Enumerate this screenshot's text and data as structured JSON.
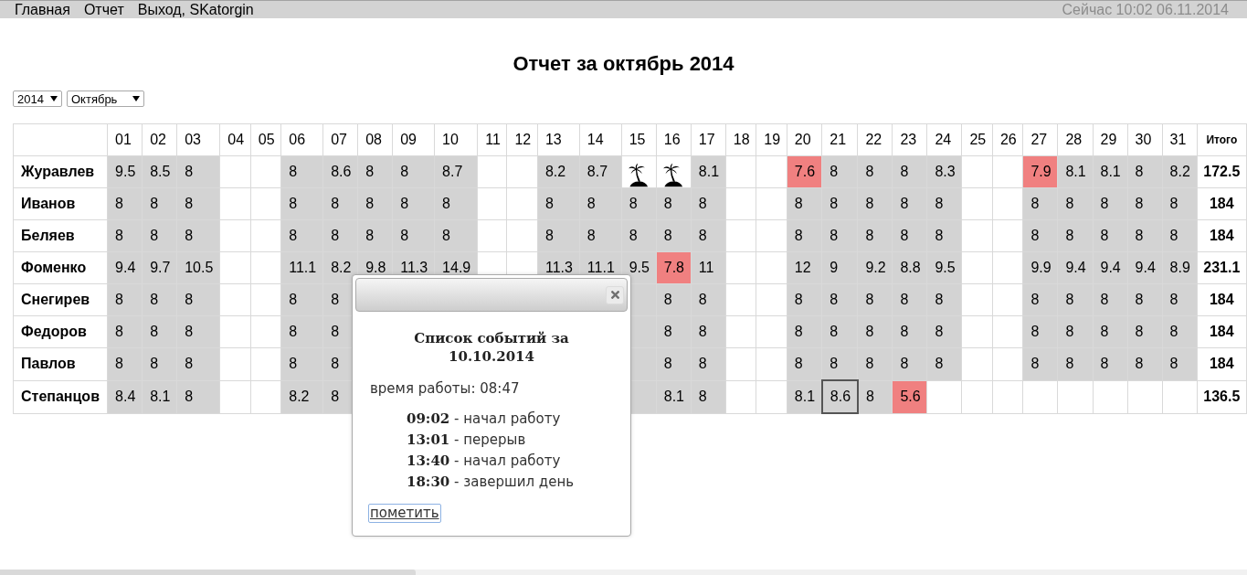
{
  "top_bar": {
    "menu": [
      {
        "label": "Главная"
      },
      {
        "label": "Отчет"
      },
      {
        "label": "Выход, SKatorgin"
      }
    ],
    "clock": "Сейчас 10:02 06.11.2014"
  },
  "title": "Отчет за октябрь 2014",
  "filters": [
    {
      "value": "2014"
    },
    {
      "value": "Октябрь"
    }
  ],
  "table": {
    "columns": [
      "01",
      "02",
      "03",
      "04",
      "05",
      "06",
      "07",
      "08",
      "09",
      "10",
      "11",
      "12",
      "13",
      "14",
      "15",
      "16",
      "17",
      "18",
      "19",
      "20",
      "21",
      "22",
      "23",
      "24",
      "25",
      "26",
      "27",
      "28",
      "29",
      "30",
      "31"
    ],
    "total_column": "Итого",
    "rows": [
      {
        "name": "Журавлев",
        "total": "172.5",
        "cells": [
          {
            "kind": "work",
            "value": "9.5",
            "selected": false
          },
          {
            "kind": "work",
            "value": "8.5",
            "selected": false
          },
          {
            "kind": "work",
            "value": "8",
            "selected": false
          },
          {
            "kind": "weekend",
            "selected": false
          },
          {
            "kind": "weekend",
            "selected": false
          },
          {
            "kind": "work",
            "value": "8",
            "selected": false
          },
          {
            "kind": "work",
            "value": "8.6",
            "selected": false
          },
          {
            "kind": "work",
            "value": "8",
            "selected": false
          },
          {
            "kind": "work",
            "value": "8",
            "selected": false
          },
          {
            "kind": "work",
            "value": "8.7",
            "selected": false
          },
          {
            "kind": "weekend",
            "selected": false
          },
          {
            "kind": "weekend",
            "selected": false
          },
          {
            "kind": "work",
            "value": "8.2",
            "selected": false
          },
          {
            "kind": "work",
            "value": "8.7",
            "selected": false
          },
          {
            "kind": "vacation",
            "selected": false
          },
          {
            "kind": "vacation",
            "selected": false
          },
          {
            "kind": "work",
            "value": "8.1",
            "selected": false
          },
          {
            "kind": "weekend",
            "selected": false
          },
          {
            "kind": "weekend",
            "selected": false
          },
          {
            "kind": "short",
            "value": "7.6",
            "selected": false
          },
          {
            "kind": "work",
            "value": "8",
            "selected": false
          },
          {
            "kind": "work",
            "value": "8",
            "selected": false
          },
          {
            "kind": "work",
            "value": "8",
            "selected": false
          },
          {
            "kind": "work",
            "value": "8.3",
            "selected": false
          },
          {
            "kind": "weekend",
            "selected": false
          },
          {
            "kind": "weekend",
            "selected": false
          },
          {
            "kind": "short",
            "value": "7.9",
            "selected": false
          },
          {
            "kind": "work",
            "value": "8.1",
            "selected": false
          },
          {
            "kind": "work",
            "value": "8.1",
            "selected": false
          },
          {
            "kind": "work",
            "value": "8",
            "selected": false
          },
          {
            "kind": "work",
            "value": "8.2",
            "selected": false
          }
        ]
      },
      {
        "name": "Иванов",
        "total": "184",
        "cells": [
          {
            "kind": "work",
            "value": "8",
            "selected": false
          },
          {
            "kind": "work",
            "value": "8",
            "selected": false
          },
          {
            "kind": "work",
            "value": "8",
            "selected": false
          },
          {
            "kind": "weekend",
            "selected": false
          },
          {
            "kind": "weekend",
            "selected": false
          },
          {
            "kind": "work",
            "value": "8",
            "selected": false
          },
          {
            "kind": "work",
            "value": "8",
            "selected": false
          },
          {
            "kind": "work",
            "value": "8",
            "selected": false
          },
          {
            "kind": "work",
            "value": "8",
            "selected": false
          },
          {
            "kind": "work",
            "value": "8",
            "selected": false
          },
          {
            "kind": "weekend",
            "selected": false
          },
          {
            "kind": "weekend",
            "selected": false
          },
          {
            "kind": "work",
            "value": "8",
            "selected": false
          },
          {
            "kind": "work",
            "value": "8",
            "selected": false
          },
          {
            "kind": "work",
            "value": "8",
            "selected": false
          },
          {
            "kind": "work",
            "value": "8",
            "selected": false
          },
          {
            "kind": "work",
            "value": "8",
            "selected": false
          },
          {
            "kind": "weekend",
            "selected": false
          },
          {
            "kind": "weekend",
            "selected": false
          },
          {
            "kind": "work",
            "value": "8",
            "selected": false
          },
          {
            "kind": "work",
            "value": "8",
            "selected": false
          },
          {
            "kind": "work",
            "value": "8",
            "selected": false
          },
          {
            "kind": "work",
            "value": "8",
            "selected": false
          },
          {
            "kind": "work",
            "value": "8",
            "selected": false
          },
          {
            "kind": "weekend",
            "selected": false
          },
          {
            "kind": "weekend",
            "selected": false
          },
          {
            "kind": "work",
            "value": "8",
            "selected": false
          },
          {
            "kind": "work",
            "value": "8",
            "selected": false
          },
          {
            "kind": "work",
            "value": "8",
            "selected": false
          },
          {
            "kind": "work",
            "value": "8",
            "selected": false
          },
          {
            "kind": "work",
            "value": "8",
            "selected": false
          }
        ]
      },
      {
        "name": "Беляев",
        "total": "184",
        "cells": [
          {
            "kind": "work",
            "value": "8",
            "selected": false
          },
          {
            "kind": "work",
            "value": "8",
            "selected": false
          },
          {
            "kind": "work",
            "value": "8",
            "selected": false
          },
          {
            "kind": "weekend",
            "selected": false
          },
          {
            "kind": "weekend",
            "selected": false
          },
          {
            "kind": "work",
            "value": "8",
            "selected": false
          },
          {
            "kind": "work",
            "value": "8",
            "selected": false
          },
          {
            "kind": "work",
            "value": "8",
            "selected": false
          },
          {
            "kind": "work",
            "value": "8",
            "selected": false
          },
          {
            "kind": "work",
            "value": "8",
            "selected": false
          },
          {
            "kind": "weekend",
            "selected": false
          },
          {
            "kind": "weekend",
            "selected": false
          },
          {
            "kind": "work",
            "value": "8",
            "selected": false
          },
          {
            "kind": "work",
            "value": "8",
            "selected": false
          },
          {
            "kind": "work",
            "value": "8",
            "selected": false
          },
          {
            "kind": "work",
            "value": "8",
            "selected": false
          },
          {
            "kind": "work",
            "value": "8",
            "selected": false
          },
          {
            "kind": "weekend",
            "selected": false
          },
          {
            "kind": "weekend",
            "selected": false
          },
          {
            "kind": "work",
            "value": "8",
            "selected": false
          },
          {
            "kind": "work",
            "value": "8",
            "selected": false
          },
          {
            "kind": "work",
            "value": "8",
            "selected": false
          },
          {
            "kind": "work",
            "value": "8",
            "selected": false
          },
          {
            "kind": "work",
            "value": "8",
            "selected": false
          },
          {
            "kind": "weekend",
            "selected": false
          },
          {
            "kind": "weekend",
            "selected": false
          },
          {
            "kind": "work",
            "value": "8",
            "selected": false
          },
          {
            "kind": "work",
            "value": "8",
            "selected": false
          },
          {
            "kind": "work",
            "value": "8",
            "selected": false
          },
          {
            "kind": "work",
            "value": "8",
            "selected": false
          },
          {
            "kind": "work",
            "value": "8",
            "selected": false
          }
        ]
      },
      {
        "name": "Фоменко",
        "total": "231.1",
        "cells": [
          {
            "kind": "work",
            "value": "9.4",
            "selected": false
          },
          {
            "kind": "work",
            "value": "9.7",
            "selected": false
          },
          {
            "kind": "work",
            "value": "10.5",
            "selected": false
          },
          {
            "kind": "weekend",
            "selected": false
          },
          {
            "kind": "weekend",
            "selected": false
          },
          {
            "kind": "work",
            "value": "11.1",
            "selected": false
          },
          {
            "kind": "work",
            "value": "8.2",
            "selected": false
          },
          {
            "kind": "work",
            "value": "9.8",
            "selected": false
          },
          {
            "kind": "work",
            "value": "11.3",
            "selected": false
          },
          {
            "kind": "work",
            "value": "14.9",
            "selected": false
          },
          {
            "kind": "weekend",
            "selected": false
          },
          {
            "kind": "weekend",
            "selected": false
          },
          {
            "kind": "work",
            "value": "11.3",
            "selected": false
          },
          {
            "kind": "work",
            "value": "11.1",
            "selected": false
          },
          {
            "kind": "work",
            "value": "9.5",
            "selected": false
          },
          {
            "kind": "short",
            "value": "7.8",
            "selected": false
          },
          {
            "kind": "work",
            "value": "11",
            "selected": false
          },
          {
            "kind": "weekend",
            "selected": false
          },
          {
            "kind": "weekend",
            "selected": false
          },
          {
            "kind": "work",
            "value": "12",
            "selected": false
          },
          {
            "kind": "work",
            "value": "9",
            "selected": false
          },
          {
            "kind": "work",
            "value": "9.2",
            "selected": false
          },
          {
            "kind": "work",
            "value": "8.8",
            "selected": false
          },
          {
            "kind": "work",
            "value": "9.5",
            "selected": false
          },
          {
            "kind": "weekend",
            "selected": false
          },
          {
            "kind": "weekend",
            "selected": false
          },
          {
            "kind": "work",
            "value": "9.9",
            "selected": false
          },
          {
            "kind": "work",
            "value": "9.4",
            "selected": false
          },
          {
            "kind": "work",
            "value": "9.4",
            "selected": false
          },
          {
            "kind": "work",
            "value": "9.4",
            "selected": false
          },
          {
            "kind": "work",
            "value": "8.9",
            "selected": false
          }
        ]
      },
      {
        "name": "Снегирев",
        "total": "184",
        "cells": [
          {
            "kind": "work",
            "value": "8",
            "selected": false
          },
          {
            "kind": "work",
            "value": "8",
            "selected": false
          },
          {
            "kind": "work",
            "value": "8",
            "selected": false
          },
          {
            "kind": "weekend",
            "selected": false
          },
          {
            "kind": "weekend",
            "selected": false
          },
          {
            "kind": "work",
            "value": "8",
            "selected": false
          },
          {
            "kind": "work",
            "value": "8",
            "selected": false
          },
          null,
          null,
          null,
          null,
          null,
          null,
          null,
          {
            "kind": "work",
            "selected": false
          },
          {
            "kind": "work",
            "value": "8",
            "selected": false
          },
          {
            "kind": "work",
            "value": "8",
            "selected": false
          },
          {
            "kind": "weekend",
            "selected": false
          },
          {
            "kind": "weekend",
            "selected": false
          },
          {
            "kind": "work",
            "value": "8",
            "selected": false
          },
          {
            "kind": "work",
            "value": "8",
            "selected": false
          },
          {
            "kind": "work",
            "value": "8",
            "selected": false
          },
          {
            "kind": "work",
            "value": "8",
            "selected": false
          },
          {
            "kind": "work",
            "value": "8",
            "selected": false
          },
          {
            "kind": "weekend",
            "selected": false
          },
          {
            "kind": "weekend",
            "selected": false
          },
          {
            "kind": "work",
            "value": "8",
            "selected": false
          },
          {
            "kind": "work",
            "value": "8",
            "selected": false
          },
          {
            "kind": "work",
            "value": "8",
            "selected": false
          },
          {
            "kind": "work",
            "value": "8",
            "selected": false
          },
          {
            "kind": "work",
            "value": "8",
            "selected": false
          }
        ]
      },
      {
        "name": "Федоров",
        "total": "184",
        "cells": [
          {
            "kind": "work",
            "value": "8",
            "selected": false
          },
          {
            "kind": "work",
            "value": "8",
            "selected": false
          },
          {
            "kind": "work",
            "value": "8",
            "selected": false
          },
          {
            "kind": "weekend",
            "selected": false
          },
          {
            "kind": "weekend",
            "selected": false
          },
          {
            "kind": "work",
            "value": "8",
            "selected": false
          },
          {
            "kind": "work",
            "value": "8",
            "selected": false
          },
          null,
          null,
          null,
          null,
          null,
          null,
          null,
          {
            "kind": "work",
            "selected": false
          },
          {
            "kind": "work",
            "value": "8",
            "selected": false
          },
          {
            "kind": "work",
            "value": "8",
            "selected": false
          },
          {
            "kind": "weekend",
            "selected": false
          },
          {
            "kind": "weekend",
            "selected": false
          },
          {
            "kind": "work",
            "value": "8",
            "selected": false
          },
          {
            "kind": "work",
            "value": "8",
            "selected": false
          },
          {
            "kind": "work",
            "value": "8",
            "selected": false
          },
          {
            "kind": "work",
            "value": "8",
            "selected": false
          },
          {
            "kind": "work",
            "value": "8",
            "selected": false
          },
          {
            "kind": "weekend",
            "selected": false
          },
          {
            "kind": "weekend",
            "selected": false
          },
          {
            "kind": "work",
            "value": "8",
            "selected": false
          },
          {
            "kind": "work",
            "value": "8",
            "selected": false
          },
          {
            "kind": "work",
            "value": "8",
            "selected": false
          },
          {
            "kind": "work",
            "value": "8",
            "selected": false
          },
          {
            "kind": "work",
            "value": "8",
            "selected": false
          }
        ]
      },
      {
        "name": "Павлов",
        "total": "184",
        "cells": [
          {
            "kind": "work",
            "value": "8",
            "selected": false
          },
          {
            "kind": "work",
            "value": "8",
            "selected": false
          },
          {
            "kind": "work",
            "value": "8",
            "selected": false
          },
          {
            "kind": "weekend",
            "selected": false
          },
          {
            "kind": "weekend",
            "selected": false
          },
          {
            "kind": "work",
            "value": "8",
            "selected": false
          },
          {
            "kind": "work",
            "value": "8",
            "selected": false
          },
          null,
          null,
          null,
          null,
          null,
          null,
          null,
          {
            "kind": "work",
            "selected": false
          },
          {
            "kind": "work",
            "value": "8",
            "selected": false
          },
          {
            "kind": "work",
            "value": "8",
            "selected": false
          },
          {
            "kind": "weekend",
            "selected": false
          },
          {
            "kind": "weekend",
            "selected": false
          },
          {
            "kind": "work",
            "value": "8",
            "selected": false
          },
          {
            "kind": "work",
            "value": "8",
            "selected": false
          },
          {
            "kind": "work",
            "value": "8",
            "selected": false
          },
          {
            "kind": "work",
            "value": "8",
            "selected": false
          },
          {
            "kind": "work",
            "value": "8",
            "selected": false
          },
          {
            "kind": "weekend",
            "selected": false
          },
          {
            "kind": "weekend",
            "selected": false
          },
          {
            "kind": "work",
            "value": "8",
            "selected": false
          },
          {
            "kind": "work",
            "value": "8",
            "selected": false
          },
          {
            "kind": "work",
            "value": "8",
            "selected": false
          },
          {
            "kind": "work",
            "value": "8",
            "selected": false
          },
          {
            "kind": "work",
            "value": "8",
            "selected": false
          }
        ]
      },
      {
        "name": "Степанцов",
        "total": "136.5",
        "cells": [
          {
            "kind": "work",
            "value": "8.4",
            "selected": false
          },
          {
            "kind": "work",
            "value": "8.1",
            "selected": false
          },
          {
            "kind": "work",
            "value": "8",
            "selected": false
          },
          {
            "kind": "weekend",
            "selected": false
          },
          {
            "kind": "weekend",
            "selected": false
          },
          {
            "kind": "work",
            "value": "8.2",
            "selected": false
          },
          {
            "kind": "work",
            "value": "8",
            "selected": false
          },
          null,
          null,
          null,
          null,
          null,
          null,
          null,
          {
            "kind": "work",
            "selected": false
          },
          {
            "kind": "work",
            "value": "8.1",
            "selected": false
          },
          {
            "kind": "work",
            "value": "8",
            "selected": false
          },
          {
            "kind": "weekend",
            "selected": false
          },
          {
            "kind": "weekend",
            "selected": false
          },
          {
            "kind": "work",
            "value": "8.1",
            "selected": false
          },
          {
            "kind": "work",
            "value": "8.6",
            "selected": true
          },
          {
            "kind": "work",
            "value": "8",
            "selected": false
          },
          {
            "kind": "short",
            "value": "5.6",
            "selected": false
          },
          {
            "kind": "none",
            "selected": false
          },
          {
            "kind": "weekend",
            "selected": false
          },
          {
            "kind": "weekend",
            "selected": false
          },
          {
            "kind": "none",
            "selected": false
          },
          {
            "kind": "none",
            "selected": false
          },
          {
            "kind": "none",
            "selected": false
          },
          {
            "kind": "none",
            "selected": false
          },
          {
            "kind": "none",
            "selected": false
          }
        ]
      }
    ]
  },
  "dialog": {
    "heading": "Список событий за 10.10.2014",
    "work_time": "время работы: 08:47",
    "events": [
      "**09:02** - начал работу",
      "**13:01** - перерыв",
      "**13:40** - начал работу",
      "**18:30** - завершил день"
    ],
    "action": "пометить"
  }
}
